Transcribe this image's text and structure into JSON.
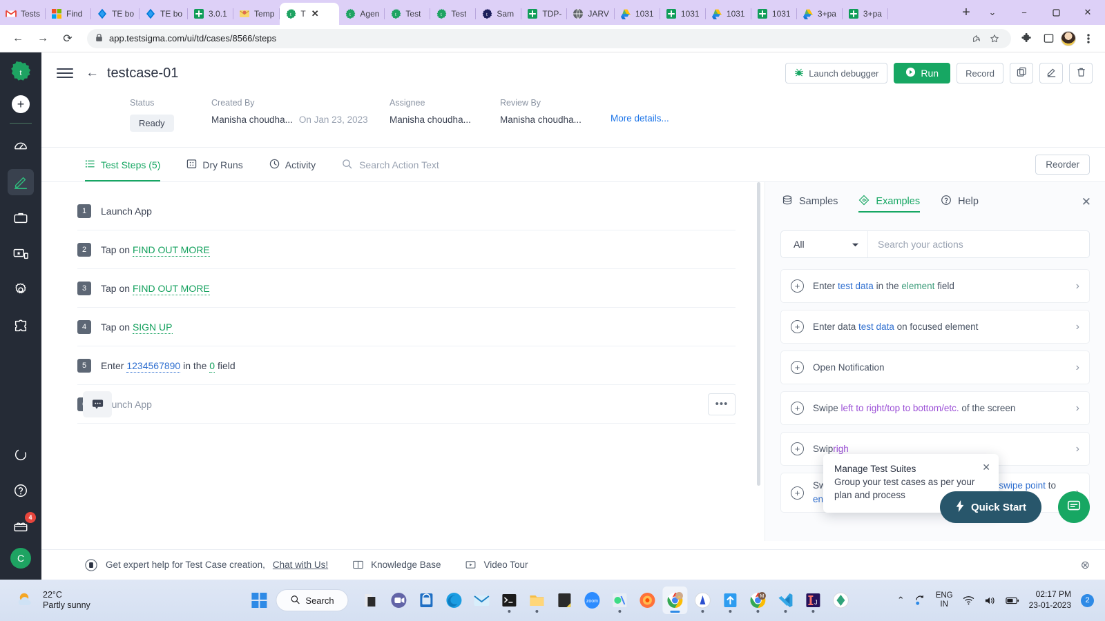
{
  "browser": {
    "tabs": [
      {
        "label": "Tests",
        "icon": "gmail-icon",
        "active": false
      },
      {
        "label": "Find ",
        "icon": "microsoft-icon",
        "active": false
      },
      {
        "label": "TE bo",
        "icon": "azure-devops-icon",
        "active": false
      },
      {
        "label": "TE bo",
        "icon": "azure-devops-icon",
        "active": false
      },
      {
        "label": "3.0.1",
        "icon": "testsigma-doc-icon",
        "active": false
      },
      {
        "label": "Temp",
        "icon": "mail-icon",
        "active": false
      },
      {
        "label": "T",
        "icon": "testsigma-icon",
        "active": true
      },
      {
        "label": "Agen",
        "icon": "testsigma-icon",
        "active": false
      },
      {
        "label": "Test ",
        "icon": "testsigma-icon",
        "active": false
      },
      {
        "label": "Test ",
        "icon": "testsigma-icon",
        "active": false
      },
      {
        "label": "Sam",
        "icon": "testsigma-dark-icon",
        "active": false
      },
      {
        "label": "TDP-",
        "icon": "testsigma-doc-icon",
        "active": false
      },
      {
        "label": "JARV",
        "icon": "globe-icon",
        "active": false
      },
      {
        "label": "1031",
        "icon": "google-drive-icon",
        "active": false
      },
      {
        "label": "1031",
        "icon": "testsigma-doc-icon",
        "active": false
      },
      {
        "label": "1031",
        "icon": "google-drive-icon",
        "active": false
      },
      {
        "label": "1031",
        "icon": "testsigma-doc-icon",
        "active": false
      },
      {
        "label": "3+pa",
        "icon": "google-drive-icon",
        "active": false
      },
      {
        "label": "3+pa",
        "icon": "testsigma-doc-icon",
        "active": false
      }
    ],
    "new_tab_label": "+",
    "window_controls": {
      "list": "⌄",
      "minimize": "−",
      "maximize": "☐",
      "close": "✕"
    },
    "url": "app.testsigma.com/ui/td/cases/8566/steps",
    "nav": {
      "back": "←",
      "forward": "→",
      "reload": "⟳"
    }
  },
  "rail": {
    "logo": "testsigma-logo",
    "add_label": "+",
    "items": [
      {
        "name": "dashboard",
        "icon": "speedometer-icon"
      },
      {
        "name": "create-tests",
        "icon": "pencil-icon",
        "active": true
      },
      {
        "name": "test-plans",
        "icon": "briefcase-icon"
      },
      {
        "name": "test-lab",
        "icon": "devices-icon"
      },
      {
        "name": "settings",
        "icon": "gear-icon"
      },
      {
        "name": "addons",
        "icon": "puzzle-icon"
      }
    ],
    "bottom_items": [
      {
        "name": "activity",
        "icon": "ring-icon"
      },
      {
        "name": "help",
        "icon": "question-circle-icon"
      },
      {
        "name": "whats-new",
        "icon": "gift-icon",
        "badge": "4"
      }
    ],
    "user_initial": "C"
  },
  "header": {
    "title": "testcase-01",
    "buttons": {
      "launch_debugger": "Launch debugger",
      "run": "Run",
      "record": "Record",
      "copy": "copy-icon",
      "edit": "edit-icon",
      "delete": "delete-icon"
    }
  },
  "meta": {
    "status_label": "Status",
    "status_value": "Ready",
    "created_by_label": "Created By",
    "created_by_value": "Manisha choudha...",
    "created_on_value": "On Jan 23, 2023",
    "assignee_label": "Assignee",
    "assignee_value": "Manisha choudha...",
    "review_by_label": "Review By",
    "review_by_value": "Manisha choudha...",
    "more_details": "More details..."
  },
  "tabs": {
    "test_steps": "Test Steps (5)",
    "dry_runs": "Dry Runs",
    "activity": "Activity",
    "search_placeholder": "Search Action Text",
    "reorder": "Reorder"
  },
  "steps": [
    {
      "num": "1",
      "parts": [
        {
          "t": "Launch App",
          "k": "plain"
        }
      ]
    },
    {
      "num": "2",
      "parts": [
        {
          "t": "Tap on ",
          "k": "plain"
        },
        {
          "t": "FIND OUT MORE",
          "k": "green"
        }
      ]
    },
    {
      "num": "3",
      "parts": [
        {
          "t": "Tap on ",
          "k": "plain"
        },
        {
          "t": "FIND OUT MORE",
          "k": "green"
        }
      ]
    },
    {
      "num": "4",
      "parts": [
        {
          "t": "Tap on ",
          "k": "plain"
        },
        {
          "t": "SIGN UP",
          "k": "green"
        }
      ]
    },
    {
      "num": "5",
      "parts": [
        {
          "t": "Enter ",
          "k": "plain"
        },
        {
          "t": "1234567890",
          "k": "blue"
        },
        {
          "t": " in the ",
          "k": "plain"
        },
        {
          "t": "0",
          "k": "green"
        },
        {
          "t": " field",
          "k": "plain"
        }
      ]
    },
    {
      "num": "6",
      "parts": [
        {
          "t": "Launch App",
          "k": "muted"
        }
      ],
      "draft": true,
      "menu": "•••",
      "comment_icon": "comment-icon"
    }
  ],
  "right_panel": {
    "tabs": {
      "samples": "Samples",
      "examples": "Examples",
      "help": "Help"
    },
    "close": "✕",
    "filter_value": "All",
    "search_placeholder": "Search your actions",
    "actions": [
      {
        "parts": [
          {
            "t": "Enter ",
            "k": "plain"
          },
          {
            "t": "test data",
            "k": "blue"
          },
          {
            "t": " in the ",
            "k": "plain"
          },
          {
            "t": "element",
            "k": "green"
          },
          {
            "t": " field",
            "k": "plain"
          }
        ]
      },
      {
        "parts": [
          {
            "t": "Enter data ",
            "k": "plain"
          },
          {
            "t": "test data",
            "k": "blue"
          },
          {
            "t": " on focused element",
            "k": "plain"
          }
        ]
      },
      {
        "parts": [
          {
            "t": "Open Notification",
            "k": "plain"
          }
        ]
      },
      {
        "parts": [
          {
            "t": "Swipe ",
            "k": "plain"
          },
          {
            "t": "left to right/top to bottom/etc.",
            "k": "purple"
          },
          {
            "t": " of the screen",
            "k": "plain"
          }
        ]
      },
      {
        "parts": [
          {
            "t": "Swip",
            "k": "plain"
          },
          {
            "t": "righ",
            "k": "purple"
          }
        ]
      },
      {
        "parts": [
          {
            "t": "Swipe on coordinates relative to screen ",
            "k": "plain"
          },
          {
            "t": "start swipe point",
            "k": "blue"
          },
          {
            "t": " to ",
            "k": "plain"
          },
          {
            "t": "end swipe point",
            "k": "blue"
          }
        ]
      }
    ],
    "tooltip": {
      "title": "Manage Test Suites",
      "body": "Group your test cases as per your plan and process",
      "close": "✕"
    },
    "quick_start": "Quick Start",
    "chat_icon": "chat-icon"
  },
  "help_bar": {
    "text": "Get expert help for Test Case creation,",
    "link": "Chat with Us!",
    "knowledge_base": "Knowledge Base",
    "video_tour": "Video Tour",
    "close": "⊗"
  },
  "taskbar": {
    "weather_temp": "22°C",
    "weather_desc": "Partly sunny",
    "search_label": "Search",
    "apps": [
      {
        "name": "file-explorer-dark-icon"
      },
      {
        "name": "teams-icon"
      },
      {
        "name": "microsoft-store-icon"
      },
      {
        "name": "edge-icon"
      },
      {
        "name": "mail-icon"
      },
      {
        "name": "terminal-icon",
        "running": true
      },
      {
        "name": "file-explorer-icon",
        "running": true
      },
      {
        "name": "sticky-notes-icon"
      },
      {
        "name": "zoom-icon"
      },
      {
        "name": "android-studio-icon",
        "running": true
      },
      {
        "name": "firefox-icon"
      },
      {
        "name": "chrome-profile-icon",
        "active": true
      },
      {
        "name": "app-icon",
        "running": true
      },
      {
        "name": "upload-icon",
        "running": true
      },
      {
        "name": "chrome-m-icon",
        "running": true
      },
      {
        "name": "vscode-icon",
        "running": true
      },
      {
        "name": "intellij-icon",
        "running": true
      },
      {
        "name": "sketch-icon"
      }
    ],
    "tray": {
      "chevron": "⌃",
      "lang_line1": "ENG",
      "lang_line2": "IN",
      "time": "02:17 PM",
      "date": "23-01-2023",
      "notification_count": "2"
    }
  },
  "colors": {
    "accent_green": "#17a763",
    "link_blue": "#1a73e8",
    "rail_bg": "#252b36",
    "tabbar_purple": "#ddd0f7"
  }
}
